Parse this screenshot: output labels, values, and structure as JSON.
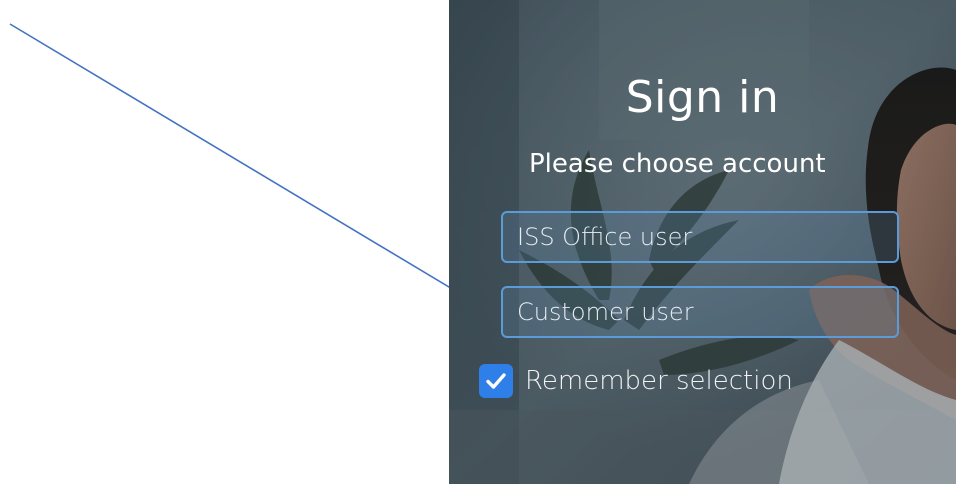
{
  "signin": {
    "title": "Sign in",
    "subtitle": "Please choose account",
    "options": [
      {
        "label": "ISS Office user"
      },
      {
        "label": "Customer user"
      }
    ],
    "remember": {
      "label": "Remember selection",
      "checked": true
    }
  },
  "colors": {
    "annotation_arrow": "#4472c4",
    "option_border": "#5b9bd8",
    "checkbox_fill": "#2f7fe8",
    "panel_bg": "#3c4b55"
  },
  "icons": {
    "checkbox": "check-icon",
    "annotation": "arrow-icon"
  }
}
